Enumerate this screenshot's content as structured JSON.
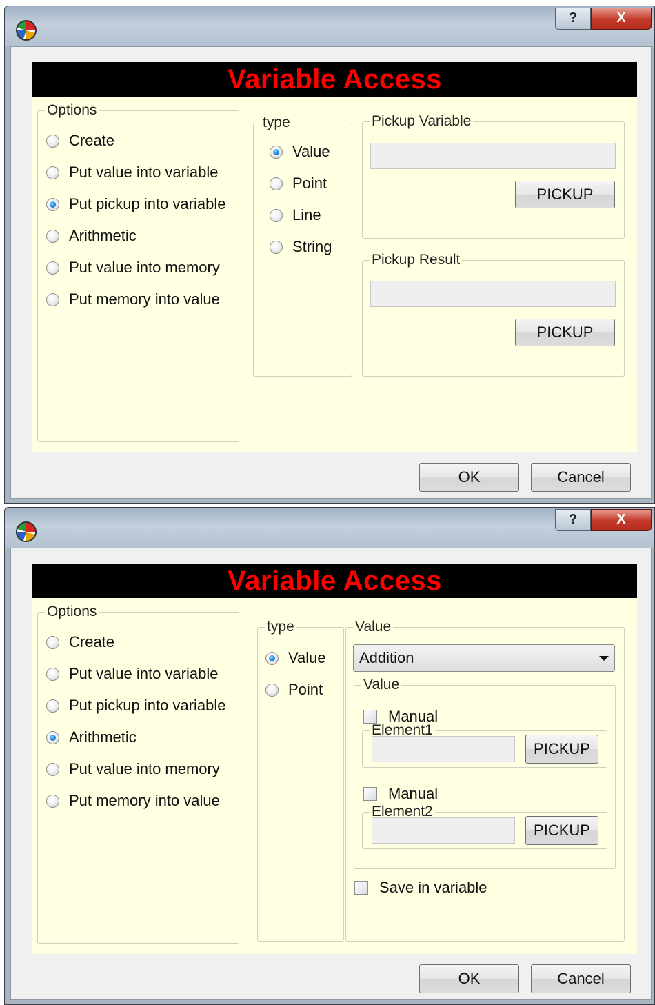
{
  "window1": {
    "title_controls": {
      "help": "?",
      "close": "X"
    },
    "banner": "Variable Access",
    "options": {
      "legend": "Options",
      "items": [
        {
          "label": "Create",
          "selected": false
        },
        {
          "label": "Put value into variable",
          "selected": false
        },
        {
          "label": "Put pickup into variable",
          "selected": true
        },
        {
          "label": "Arithmetic",
          "selected": false
        },
        {
          "label": "Put value into memory",
          "selected": false
        },
        {
          "label": "Put memory into value",
          "selected": false
        }
      ]
    },
    "type": {
      "legend": "type",
      "items": [
        {
          "label": "Value",
          "selected": true
        },
        {
          "label": "Point",
          "selected": false
        },
        {
          "label": "Line",
          "selected": false
        },
        {
          "label": "String",
          "selected": false
        }
      ]
    },
    "pickup_variable": {
      "legend": "Pickup Variable",
      "value": "",
      "button": "PICKUP"
    },
    "pickup_result": {
      "legend": "Pickup Result",
      "value": "",
      "button": "PICKUP"
    },
    "footer": {
      "ok": "OK",
      "cancel": "Cancel"
    }
  },
  "window2": {
    "title_controls": {
      "help": "?",
      "close": "X"
    },
    "banner": "Variable Access",
    "options": {
      "legend": "Options",
      "items": [
        {
          "label": "Create",
          "selected": false
        },
        {
          "label": "Put value into variable",
          "selected": false
        },
        {
          "label": "Put pickup into variable",
          "selected": false
        },
        {
          "label": "Arithmetic",
          "selected": true
        },
        {
          "label": "Put value into memory",
          "selected": false
        },
        {
          "label": "Put memory into value",
          "selected": false
        }
      ]
    },
    "type": {
      "legend": "type",
      "items": [
        {
          "label": "Value",
          "selected": true
        },
        {
          "label": "Point",
          "selected": false
        }
      ]
    },
    "value_group": {
      "legend": "Value",
      "operation": "Addition",
      "inner_legend": "Value",
      "manual1": {
        "label": "Manual",
        "checked": false
      },
      "element1": {
        "legend": "Element1",
        "value": "",
        "button": "PICKUP"
      },
      "manual2": {
        "label": "Manual",
        "checked": false
      },
      "element2": {
        "legend": "Element2",
        "value": "",
        "button": "PICKUP"
      },
      "save_in_variable": {
        "label": "Save in variable",
        "checked": false
      }
    },
    "footer": {
      "ok": "OK",
      "cancel": "Cancel"
    }
  }
}
